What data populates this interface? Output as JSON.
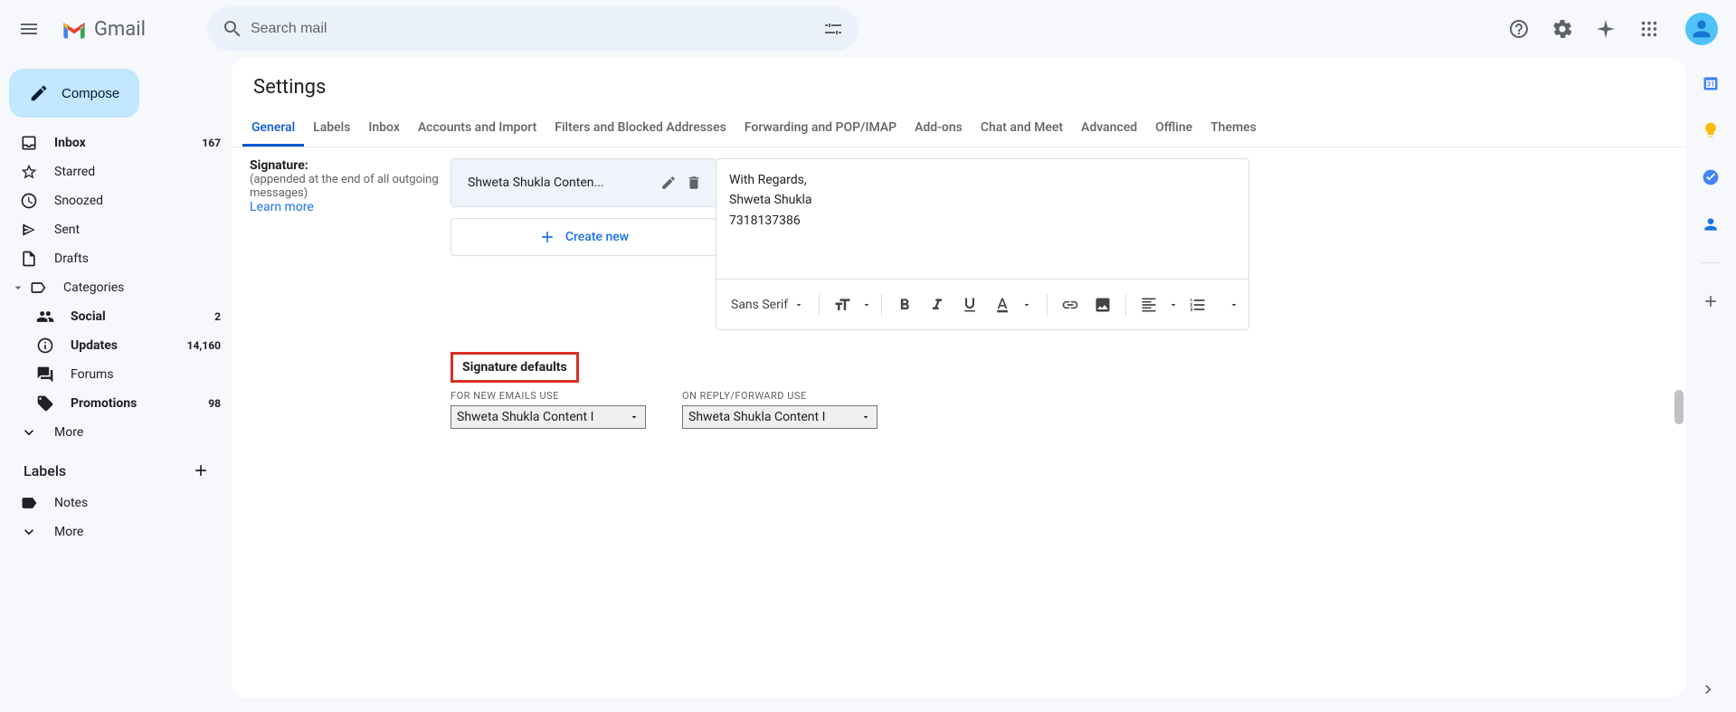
{
  "header": {
    "product_name": "Gmail",
    "search_placeholder": "Search mail"
  },
  "sidebar": {
    "compose_label": "Compose",
    "items": [
      {
        "label": "Inbox",
        "count": "167",
        "bold": true
      },
      {
        "label": "Starred",
        "count": ""
      },
      {
        "label": "Snoozed",
        "count": ""
      },
      {
        "label": "Sent",
        "count": ""
      },
      {
        "label": "Drafts",
        "count": ""
      },
      {
        "label": "Categories",
        "count": ""
      }
    ],
    "categories": [
      {
        "label": "Social",
        "count": "2",
        "bold": true
      },
      {
        "label": "Updates",
        "count": "14,160",
        "bold": true
      },
      {
        "label": "Forums",
        "count": ""
      },
      {
        "label": "Promotions",
        "count": "98",
        "bold": true
      }
    ],
    "more_label": "More",
    "labels_header": "Labels",
    "label_items": [
      {
        "label": "Notes"
      }
    ],
    "labels_more": "More"
  },
  "settings": {
    "title": "Settings",
    "tabs": [
      "General",
      "Labels",
      "Inbox",
      "Accounts and Import",
      "Filters and Blocked Addresses",
      "Forwarding and POP/IMAP",
      "Add-ons",
      "Chat and Meet",
      "Advanced",
      "Offline",
      "Themes"
    ],
    "signature": {
      "label": "Signature:",
      "sub": "(appended at the end of all outgoing messages)",
      "learn_more": "Learn more",
      "selected_name": "Shweta Shukla Conten...",
      "content_line1": "With Regards,",
      "content_line2": "Shweta Shukla",
      "content_line3": "7318137386",
      "font_name": "Sans Serif",
      "create_new": "Create new",
      "defaults_title": "Signature defaults",
      "for_new_label": "FOR NEW EMAILS USE",
      "on_reply_label": "ON REPLY/FORWARD USE",
      "for_new_value": "Shweta Shukla Content I",
      "on_reply_value": "Shweta Shukla Content I"
    }
  }
}
